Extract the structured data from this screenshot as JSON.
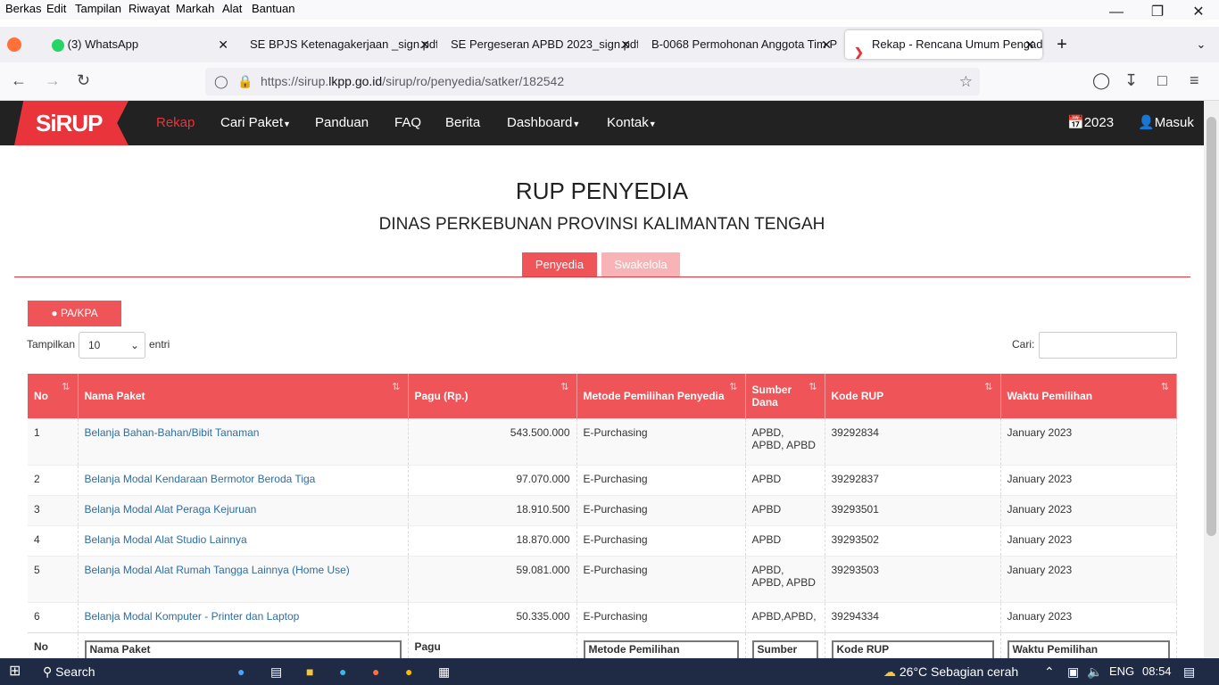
{
  "menubar": {
    "items": [
      "Berkas",
      "Edit",
      "Tampilan",
      "Riwayat",
      "Markah",
      "Alat",
      "Bantuan"
    ]
  },
  "tabs": [
    {
      "label": "(3) WhatsApp",
      "badge": "3"
    },
    {
      "label": "SE BPJS Ketenagakerjaan _sign.pdf"
    },
    {
      "label": "SE Pergeseran APBD 2023_sign.pdf"
    },
    {
      "label": "B-0068 Permohonan Anggota Tim P"
    },
    {
      "label": "Rekap - Rencana Umum Pengad"
    }
  ],
  "url": {
    "prefix": "https://sirup.",
    "domain": "lkpp.go.id",
    "path": "/sirup/ro/penyedia/satker/182542"
  },
  "site": {
    "logo": "SiRUP",
    "nav": [
      "Rekap",
      "Cari Paket",
      "Panduan",
      "FAQ",
      "Berita",
      "Dashboard",
      "Kontak"
    ],
    "year": "2023",
    "login": "Masuk"
  },
  "page": {
    "title": "RUP PENYEDIA",
    "subtitle": "DINAS PERKEBUNAN PROVINSI KALIMANTAN TENGAH",
    "tab_penyedia": "Penyedia",
    "tab_swakelola": "Swakelola",
    "pa_button": "PA/KPA",
    "show_label": "Tampilkan",
    "show_value": "10",
    "entries_label": "entri",
    "search_label": "Cari:"
  },
  "table": {
    "headers": [
      "No",
      "Nama Paket",
      "Pagu (Rp.)",
      "Metode Pemilihan Penyedia",
      "Sumber Dana",
      "Kode RUP",
      "Waktu Pemilihan"
    ],
    "rows": [
      [
        "1",
        "Belanja Bahan-Bahan/Bibit Tanaman",
        "543.500.000",
        "E-Purchasing",
        "APBD, APBD, APBD",
        "39292834",
        "January 2023"
      ],
      [
        "2",
        "Belanja Modal Kendaraan Bermotor Beroda Tiga",
        "97.070.000",
        "E-Purchasing",
        "APBD",
        "39292837",
        "January 2023"
      ],
      [
        "3",
        "Belanja Modal Alat Peraga Kejuruan",
        "18.910.500",
        "E-Purchasing",
        "APBD",
        "39293501",
        "January 2023"
      ],
      [
        "4",
        "Belanja Modal Alat Studio Lainnya",
        "18.870.000",
        "E-Purchasing",
        "APBD",
        "39293502",
        "January 2023"
      ],
      [
        "5",
        "Belanja Modal Alat Rumah Tangga Lainnya (Home Use)",
        "59.081.000",
        "E-Purchasing",
        "APBD, APBD, APBD",
        "39293503",
        "January 2023"
      ],
      [
        "6",
        "Belanja Modal Komputer - Printer dan Laptop",
        "50.335.000",
        "E-Purchasing",
        "APBD,APBD,",
        "39294334",
        "January 2023"
      ]
    ],
    "footer": [
      "No",
      "Nama Paket",
      "Pagu",
      "Metode Pemilihan",
      "Sumber",
      "Kode RUP",
      "Waktu Pemilihan"
    ]
  },
  "taskbar": {
    "search": "Search",
    "weather": "26°C  Sebagian cerah",
    "lang": "ENG",
    "time": "08:54"
  },
  "colors": {
    "accent": "#ef5459",
    "brand": "#e8343a"
  }
}
